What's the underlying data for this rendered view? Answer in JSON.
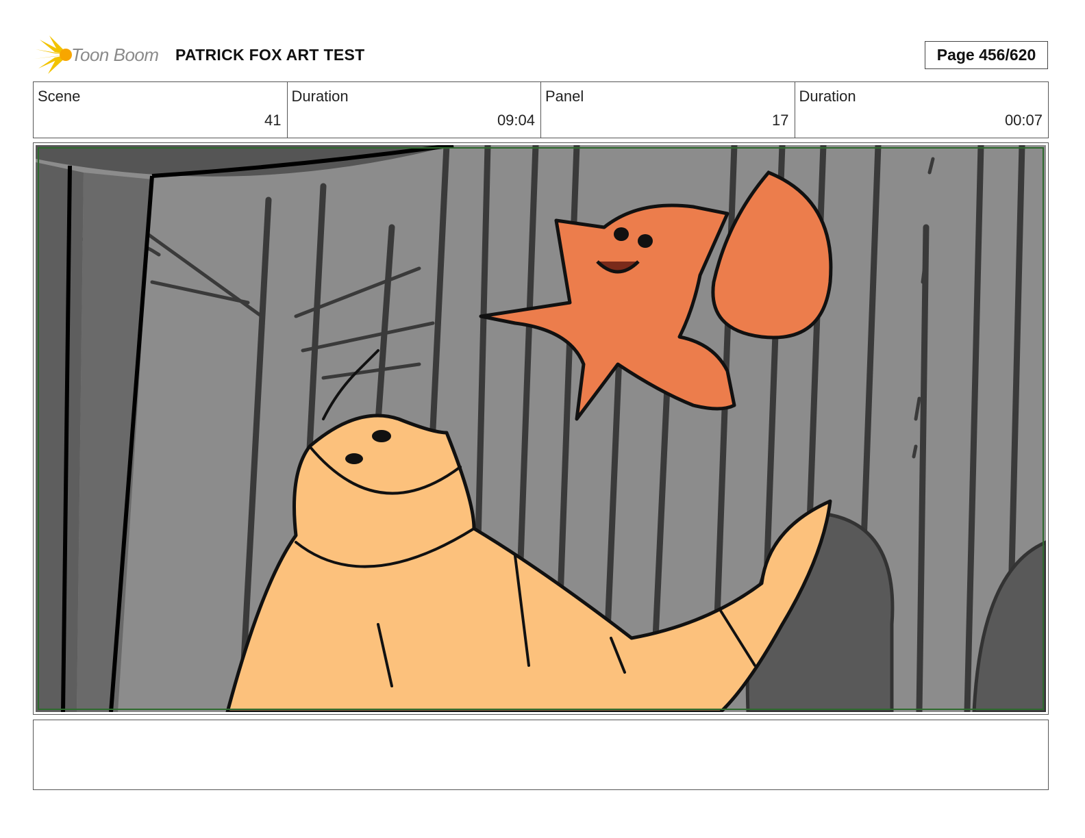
{
  "header": {
    "logo_text": "Toon Boom",
    "title": "PATRICK FOX ART TEST",
    "page": "Page 456/620"
  },
  "info": {
    "scene_label": "Scene",
    "scene_value": "41",
    "scene_duration_label": "Duration",
    "scene_duration_value": "09:04",
    "panel_label": "Panel",
    "panel_value": "17",
    "panel_duration_label": "Duration",
    "panel_duration_value": "00:07"
  },
  "panel": {
    "image_subject": "storyboard-panel-fox-and-toad-in-forest"
  },
  "notes": {
    "text": ""
  },
  "colors": {
    "fox": "#ec7d4c",
    "toad": "#fcc17c",
    "background": "#8c8c8c",
    "frame_guide": "#2e6b2e",
    "logo_burst": "#f2c300"
  }
}
